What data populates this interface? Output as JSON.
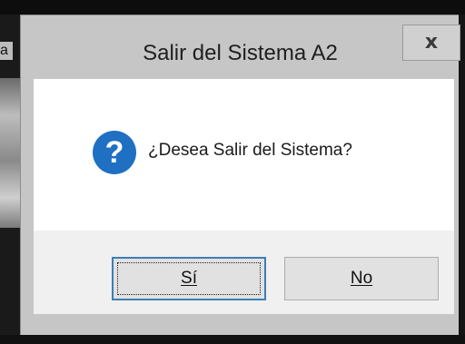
{
  "dialog": {
    "title": "Salir del Sistema A2",
    "close_label": "x",
    "message": "¿Desea Salir del Sistema?",
    "icon": "question-icon",
    "buttons": {
      "yes_label": "Sí",
      "no_label": "No"
    },
    "accent_color": "#1f6fc2"
  },
  "background": {
    "partial_text": "a"
  }
}
